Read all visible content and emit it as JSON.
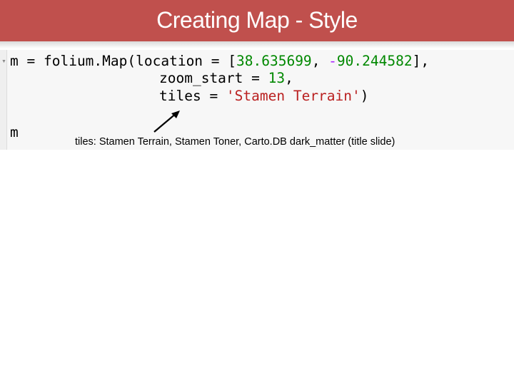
{
  "slide": {
    "title": "Creating Map - Style"
  },
  "code": {
    "line1": {
      "var": "m",
      "eq": " = ",
      "call": "folium.Map(location = ",
      "bracket_open": "[",
      "lat": "38.635699",
      "comma": ", ",
      "minus": "-",
      "lon": "90.244582",
      "bracket_close": "],"
    },
    "line2": {
      "text": "zoom_start = ",
      "value": "13",
      "tail": ","
    },
    "line3": {
      "text": "tiles = ",
      "value": "'Stamen Terrain'",
      "tail": ")"
    },
    "line4": {
      "text": "m"
    }
  },
  "annotation": {
    "caption": "tiles: Stamen Terrain, Stamen Toner, Carto.DB dark_matter (title slide)"
  },
  "colors": {
    "title_bar": "#c0504d",
    "number": "#008800",
    "string": "#ba2121",
    "operator": "#aa22ff"
  }
}
